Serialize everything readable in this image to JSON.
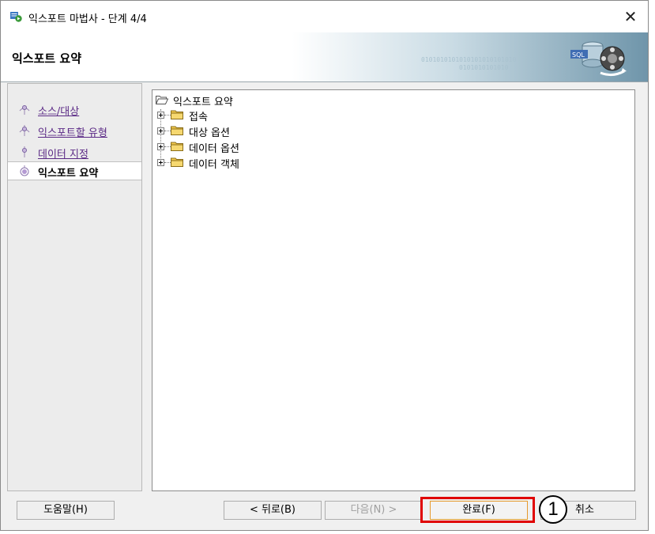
{
  "window": {
    "title": "익스포트 마법사 - 단계 4/4",
    "close_glyph": "✕"
  },
  "banner": {
    "title": "익스포트 요약",
    "bits_line1": "0101010101010101010101010",
    "bits_line2": "0101010101010"
  },
  "nav": {
    "items": [
      {
        "label": "소스/대상",
        "active": false
      },
      {
        "label": "익스포트할 유형",
        "active": false
      },
      {
        "label": "데이터 지정",
        "active": false
      },
      {
        "label": "익스포트 요약",
        "active": true
      }
    ]
  },
  "tree": {
    "root": "익스포트 요약",
    "items": [
      {
        "label": "접속"
      },
      {
        "label": "대상 옵션"
      },
      {
        "label": "데이터 옵션"
      },
      {
        "label": "데이터 객체"
      }
    ]
  },
  "buttons": {
    "help": "도움말(H)",
    "back": "< 뒤로(B)",
    "next": "다음(N) >",
    "finish": "완료(F)",
    "cancel": "취소"
  },
  "callout": {
    "number": "1"
  },
  "colors": {
    "highlight": "#e00000",
    "nav_link": "#5b2a86",
    "folder": "#f2c94c"
  },
  "icons": {
    "title": "wizard-app-icon",
    "banner": "sql-database-graphic",
    "folder": "folder-icon",
    "open_folder": "open-folder-icon",
    "expand": "plus-expand-icon",
    "step": "step-dot-icon",
    "close": "close-icon"
  }
}
